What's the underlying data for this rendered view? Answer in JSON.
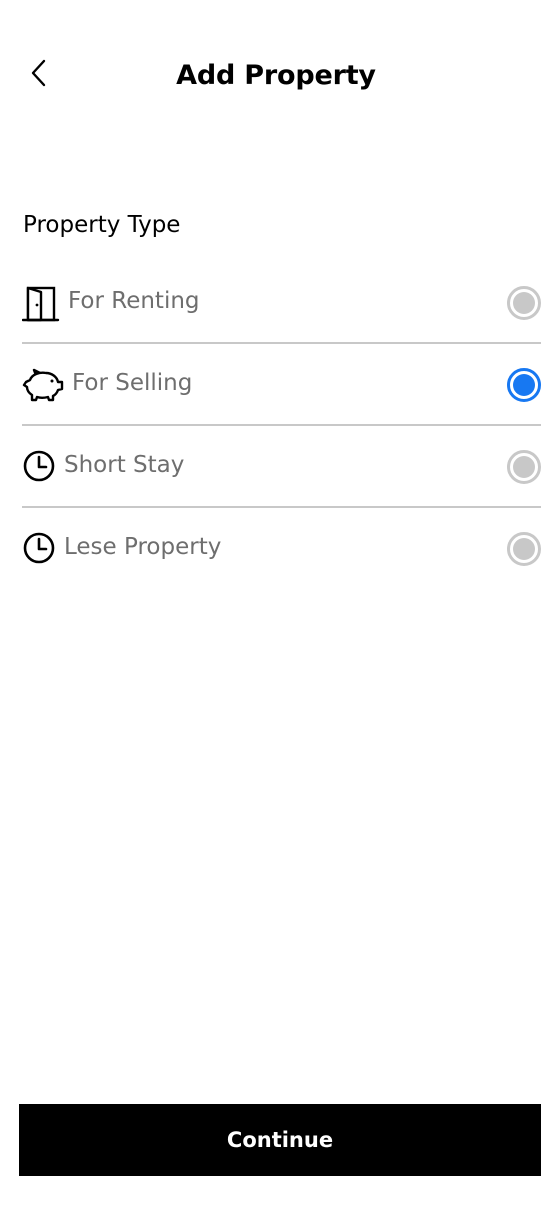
{
  "header": {
    "back_icon": "chevron-left-icon",
    "title": "Add Property"
  },
  "section": {
    "label": "Property Type"
  },
  "options": [
    {
      "label": "For Renting",
      "icon": "door-icon",
      "selected": false
    },
    {
      "label": "For Selling",
      "icon": "piggy-bank-icon",
      "selected": true
    },
    {
      "label": "Short Stay",
      "icon": "clock-icon",
      "selected": false
    },
    {
      "label": "Lese Property",
      "icon": "clock-icon",
      "selected": false
    }
  ],
  "footer": {
    "continue_label": "Continue"
  },
  "colors": {
    "accent": "#1778f2",
    "radio_inactive": "#c8c8c8",
    "button_bg": "#000000",
    "label_text": "#6e6e6e"
  }
}
